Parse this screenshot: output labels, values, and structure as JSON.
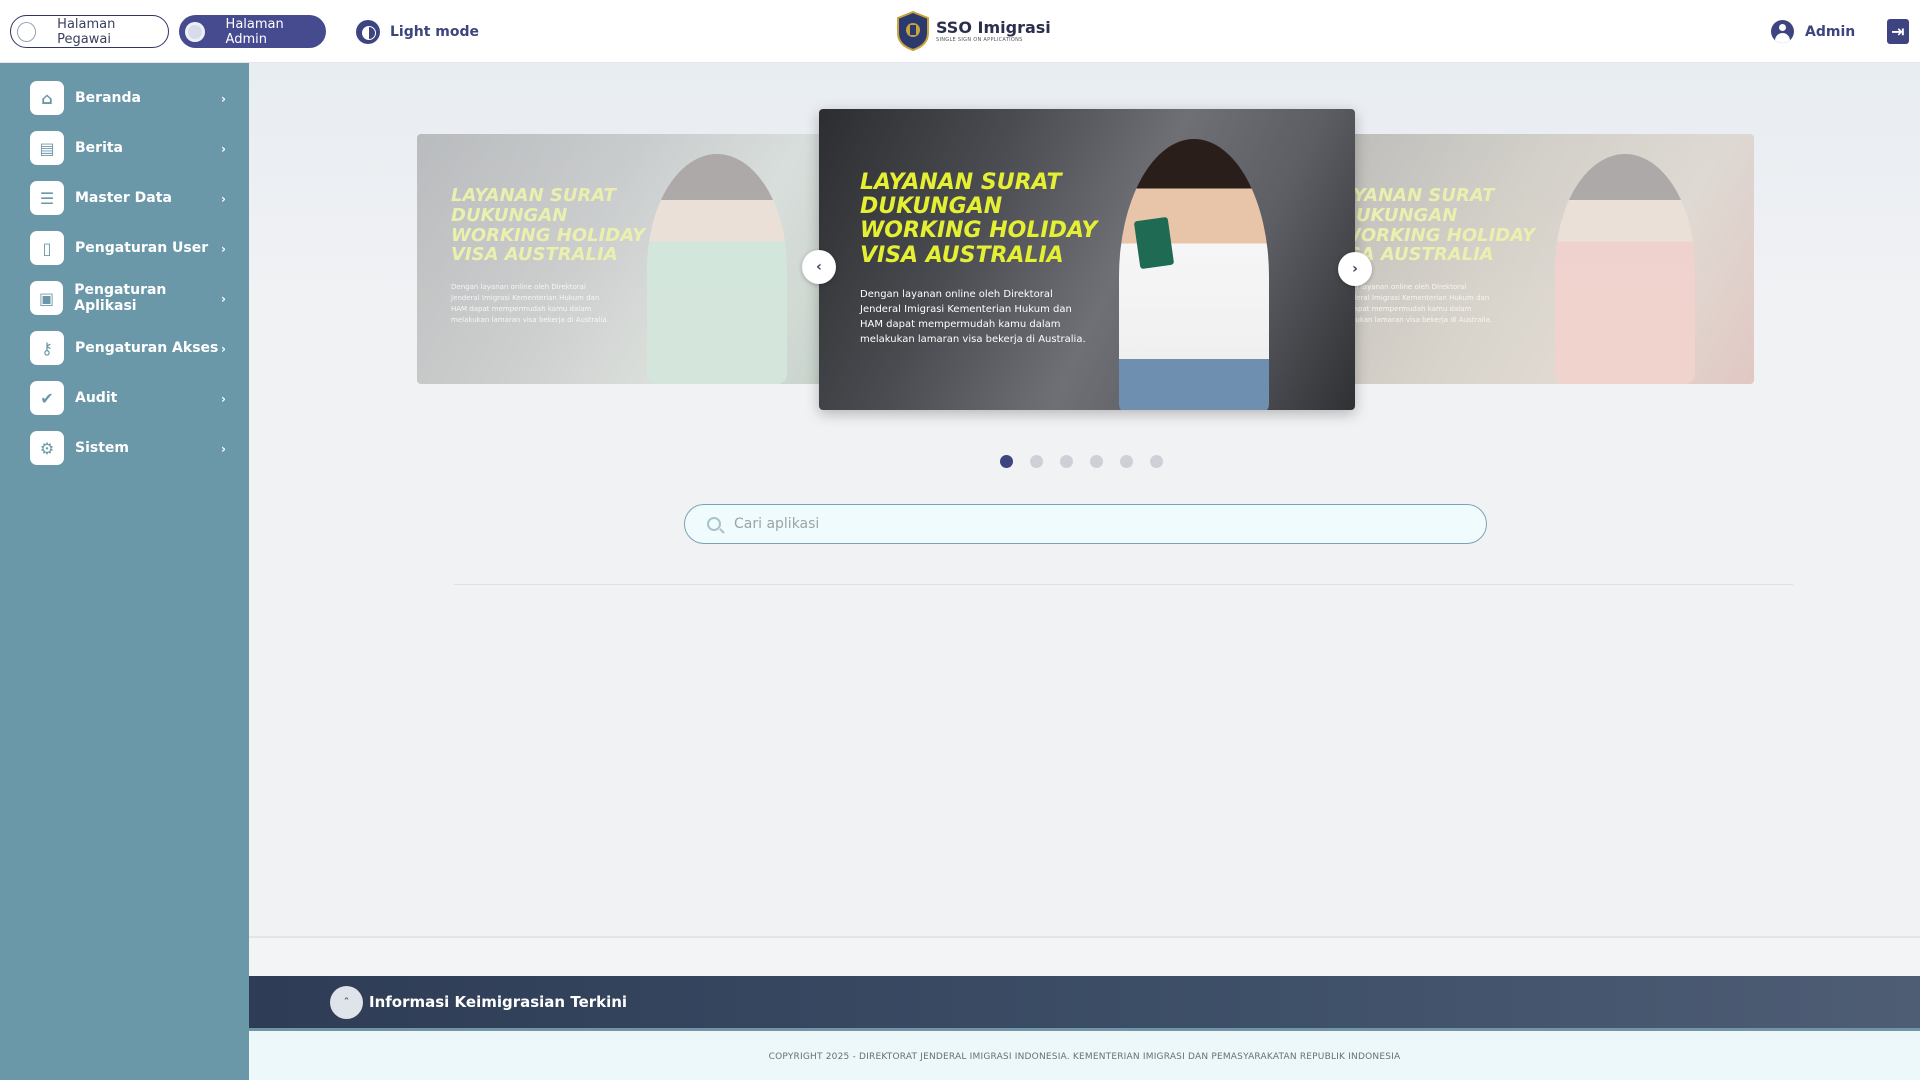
{
  "header": {
    "pill_pegawai": "Halaman Pegawai",
    "pill_admin": "Halaman Admin",
    "theme_label": "Light mode",
    "brand_title": "SSO Imigrasi",
    "brand_subtitle": "SINGLE SIGN ON APPLICATIONS",
    "user_label": "Admin"
  },
  "sidebar": {
    "items": [
      {
        "label": "Beranda",
        "icon": "home-icon"
      },
      {
        "label": "Berita",
        "icon": "news-icon"
      },
      {
        "label": "Master Data",
        "icon": "database-icon"
      },
      {
        "label": "Pengaturan User",
        "icon": "user-badge-icon"
      },
      {
        "label": "Pengaturan Aplikasi",
        "icon": "app-icon"
      },
      {
        "label": "Pengaturan Akses",
        "icon": "key-icon"
      },
      {
        "label": "Audit",
        "icon": "check-shield-icon"
      },
      {
        "label": "Sistem",
        "icon": "gear-icon"
      }
    ]
  },
  "carousel": {
    "slides": [
      {
        "headline": "LAYANAN SURAT\nDUKUNGAN\nWORKING HOLIDAY\nVISA AUSTRALIA",
        "desc": "Dengan layanan online oleh Direktoral\nJenderal Imigrasi Kementerian Hukum dan\nHAM dapat mempermudah kamu dalam\nmelakukan lamaran visa bekerja di Australia."
      },
      {
        "headline": "LAYANAN SURAT\nDUKUNGAN\nWORKING HOLIDAY\nVISA AUSTRALIA",
        "desc": "Dengan layanan online oleh Direktoral\nJenderal Imigrasi Kementerian Hukum dan\nHAM dapat mempermudah kamu dalam\nmelakukan lamaran visa bekerja di Australia."
      },
      {
        "headline": "AYANAN SURAT\nDUKUNGAN\nWORKING HOLIDAY\nISA AUSTRALIA",
        "desc": "ngan layanan online oleh Direktoral\nJenderal Imigrasi Kementerian Hukum dan\nM dapat mempermudah kamu dalam\nelakukan lamaran visa bekerja di Australia."
      }
    ],
    "prev_label": "‹",
    "next_label": "›",
    "dot_count": 6,
    "active_dot": 1
  },
  "search": {
    "placeholder": "Cari aplikasi",
    "value": ""
  },
  "infobar": {
    "toggle_label": "ˆ",
    "title": "Informasi Keimigrasian Terkini"
  },
  "footer": {
    "copyright": "COPYRIGHT 2025 - DIREKTORAT JENDERAL IMIGRASI INDONESIA. KEMENTERIAN IMIGRASI DAN PEMASYARAKATAN REPUBLIK INDONESIA"
  },
  "colors": {
    "sidebar": "#6b98a8",
    "accent": "#3d4480",
    "headline": "#e6f033",
    "infobar": "#3e4f68"
  }
}
